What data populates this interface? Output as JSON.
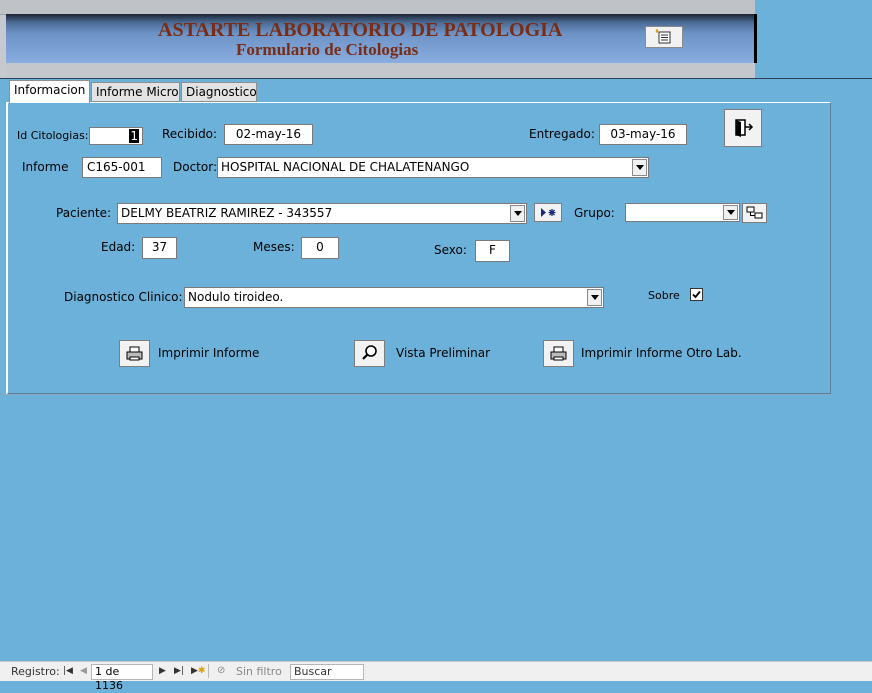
{
  "header": {
    "title": "ASTARTE LABORATORIO DE PATOLOGIA",
    "subtitle": "Formulario de Citologias",
    "button_icon": "form-list-icon"
  },
  "tabs": [
    {
      "label": "Informacion",
      "active": true
    },
    {
      "label": "Informe Micro",
      "active": false
    },
    {
      "label": "Diagnostico",
      "active": false
    }
  ],
  "form": {
    "id_label": "Id Citologias:",
    "id_value": "1",
    "recibido_label": "Recibido:",
    "recibido_value": "02-may-16",
    "entregado_label": "Entregado:",
    "entregado_value": "03-may-16",
    "informe_label": "Informe",
    "informe_value": "C165-001",
    "doctor_label": "Doctor:",
    "doctor_value": "HOSPITAL NACIONAL DE CHALATENANGO",
    "paciente_label": "Paciente:",
    "paciente_value": "DELMY BEATRIZ RAMIREZ - 343557",
    "grupo_label": "Grupo:",
    "grupo_value": "",
    "edad_label": "Edad:",
    "edad_value": "37",
    "meses_label": "Meses:",
    "meses_value": "0",
    "sexo_label": "Sexo:",
    "sexo_value": "F",
    "diag_label": "Diagnostico Clinico:",
    "diag_value": "Nodulo tiroideo.",
    "sobre_label": "Sobre",
    "sobre_checked": true
  },
  "actions": {
    "print_label": "Imprimir Informe",
    "preview_label": "Vista Preliminar",
    "print_other_label": "Imprimir Informe Otro Lab."
  },
  "statusbar": {
    "record_label": "Registro:",
    "record_value": "1 de 1136",
    "filter_label": "Sin filtro",
    "search_placeholder": "Buscar"
  },
  "colors": {
    "background": "#6cb1da",
    "title": "#7a2c14",
    "banner": "#89ade0"
  }
}
